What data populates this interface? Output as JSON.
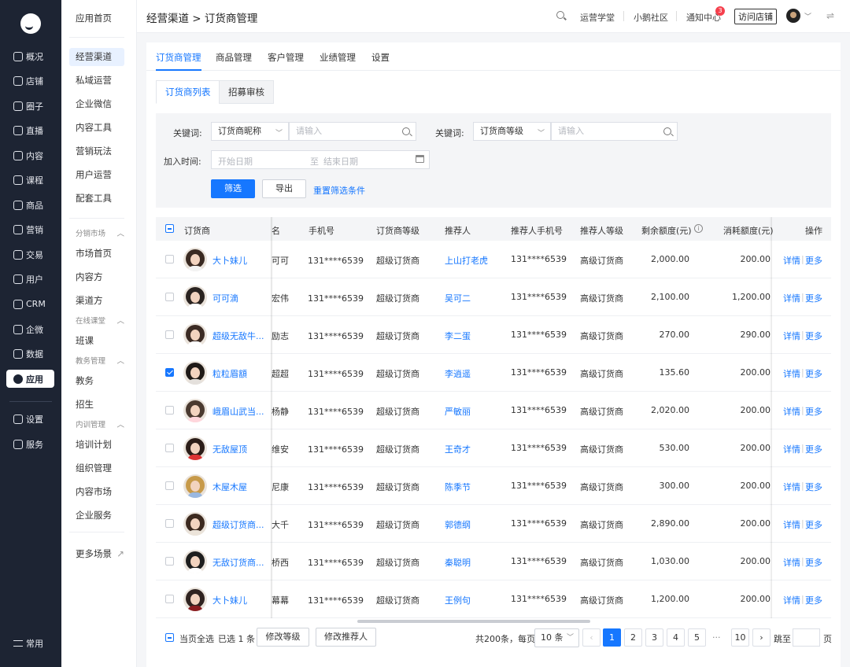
{
  "rail": {
    "items": [
      "概况",
      "店铺",
      "圈子",
      "直播",
      "内容",
      "课程",
      "商品",
      "营销",
      "交易",
      "用户",
      "CRM",
      "企微",
      "数据",
      "应用",
      "设置",
      "服务"
    ],
    "active": "应用",
    "bottom": "常用"
  },
  "submenu": {
    "top": [
      "应用首页",
      "经营渠道",
      "私域运营",
      "企业微信",
      "内容工具",
      "营销玩法",
      "用户运营",
      "配套工具"
    ],
    "active": "经营渠道",
    "groups": [
      {
        "title": "分销市场",
        "items": [
          "市场首页",
          "内容方",
          "渠道方"
        ]
      },
      {
        "title": "在线课堂",
        "items": [
          "班课"
        ]
      },
      {
        "title": "教务管理",
        "items": [
          "教务",
          "招生"
        ]
      },
      {
        "title": "内训管理",
        "items": [
          "培训计划",
          "组织管理",
          "内容市场",
          "企业服务"
        ]
      }
    ],
    "more": "更多场景"
  },
  "topbar": {
    "breadcrumb": "经营渠道 > 订货商管理",
    "links": [
      "运营学堂",
      "小鹅社区",
      "通知中心"
    ],
    "badge": "3",
    "visit": "访问店铺"
  },
  "tabs": [
    "订货商管理",
    "商品管理",
    "客户管理",
    "业绩管理",
    "设置"
  ],
  "subtabs": [
    "订货商列表",
    "招募审核"
  ],
  "filter": {
    "keyword_label": "关键词:",
    "keyword1_select": "订货商昵称",
    "keyword2_select": "订货商等级",
    "input_placeholder": "请输入",
    "join_label": "加入时间:",
    "start_placeholder": "开始日期",
    "to": "至",
    "end_placeholder": "结束日期",
    "filter_btn": "筛选",
    "export_btn": "导出",
    "reset_link": "重置筛选条件"
  },
  "table": {
    "headers": [
      "订货商",
      "名",
      "手机号",
      "订货商等级",
      "推荐人",
      "推荐人手机号",
      "推荐人等级",
      "剩余额度(元)",
      "消耗额度(元)",
      "操作"
    ],
    "detail": "详情",
    "more": "更多",
    "rows": [
      {
        "name": "大卜妹儿",
        "realname": "可可",
        "phone": "131****6539",
        "level": "超级订货商",
        "ref": "上山打老虎",
        "ref_phone": "131****6539",
        "ref_level": "高级订货商",
        "remain": "2,000.00",
        "used": "200.00",
        "checked": false
      },
      {
        "name": "可可滴",
        "realname": "宏伟",
        "phone": "131****6539",
        "level": "超级订货商",
        "ref": "吴可二",
        "ref_phone": "131****6539",
        "ref_level": "高级订货商",
        "remain": "2,100.00",
        "used": "1,200.00",
        "checked": false
      },
      {
        "name": "超级无敌牛...",
        "realname": "励志",
        "phone": "131****6539",
        "level": "超级订货商",
        "ref": "李二蛋",
        "ref_phone": "131****6539",
        "ref_level": "高级订货商",
        "remain": "270.00",
        "used": "290.00",
        "checked": false
      },
      {
        "name": "粒粒眉額",
        "realname": "超超",
        "phone": "131****6539",
        "level": "超级订货商",
        "ref": "李逍遥",
        "ref_phone": "131****6539",
        "ref_level": "高级订货商",
        "remain": "135.60",
        "used": "200.00",
        "checked": true
      },
      {
        "name": "峨眉山武当...",
        "realname": "杨静",
        "phone": "131****6539",
        "level": "超级订货商",
        "ref": "严敏丽",
        "ref_phone": "131****6539",
        "ref_level": "高级订货商",
        "remain": "2,020.00",
        "used": "200.00",
        "checked": false
      },
      {
        "name": "无敌屋顶",
        "realname": "维安",
        "phone": "131****6539",
        "level": "超级订货商",
        "ref": "王奇才",
        "ref_phone": "131****6539",
        "ref_level": "高级订货商",
        "remain": "530.00",
        "used": "200.00",
        "checked": false
      },
      {
        "name": "木屋木屋",
        "realname": "尼康",
        "phone": "131****6539",
        "level": "超级订货商",
        "ref": "陈季节",
        "ref_phone": "131****6539",
        "ref_level": "高级订货商",
        "remain": "300.00",
        "used": "200.00",
        "checked": false
      },
      {
        "name": "超级订货商...",
        "realname": "大千",
        "phone": "131****6539",
        "level": "超级订货商",
        "ref": "郭德纲",
        "ref_phone": "131****6539",
        "ref_level": "高级订货商",
        "remain": "2,890.00",
        "used": "200.00",
        "checked": false
      },
      {
        "name": "无敌订货商...",
        "realname": "桥西",
        "phone": "131****6539",
        "level": "超级订货商",
        "ref": "秦聪明",
        "ref_phone": "131****6539",
        "ref_level": "高级订货商",
        "remain": "1,030.00",
        "used": "200.00",
        "checked": false
      },
      {
        "name": "大卜妹儿",
        "realname": "幕幕",
        "phone": "131****6539",
        "level": "超级订货商",
        "ref": "王例句",
        "ref_phone": "131****6539",
        "ref_level": "高级订货商",
        "remain": "1,200.00",
        "used": "200.00",
        "checked": false
      }
    ]
  },
  "footer": {
    "select_page": "当页全选",
    "selected": "已选 1 条",
    "btn_level": "修改等级",
    "btn_ref": "修改推荐人",
    "total": "共200条，每页",
    "per_page": "10 条",
    "pages": [
      "1",
      "2",
      "3",
      "4",
      "5"
    ],
    "ellipsis": "···",
    "last_page": "10",
    "jump": "跳至",
    "page_unit": "页"
  },
  "colors": {
    "accent": "#1677ff",
    "rail_bg": "#1d2433",
    "badge": "#f5404d"
  }
}
